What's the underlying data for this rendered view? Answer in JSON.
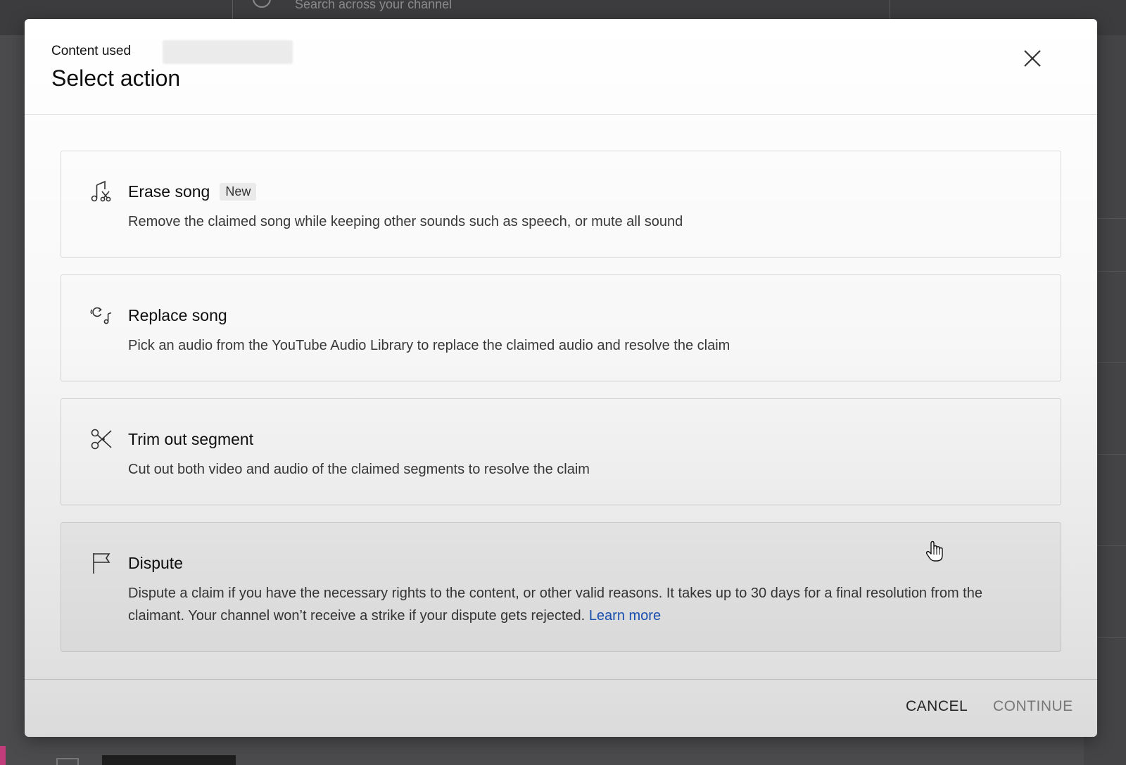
{
  "background": {
    "search_placeholder": "Search across your channel"
  },
  "dialog": {
    "subtitle": "Content used",
    "title": "Select action",
    "close_icon": "close-icon",
    "options": [
      {
        "icon": "music-scissors-icon",
        "title": "Erase song",
        "badge": "New",
        "description": "Remove the claimed song while keeping other sounds such as speech, or mute all sound"
      },
      {
        "icon": "replace-song-icon",
        "title": "Replace song",
        "description": "Pick an audio from the YouTube Audio Library to replace the claimed audio and resolve the claim"
      },
      {
        "icon": "scissors-icon",
        "title": "Trim out segment",
        "description": "Cut out both video and audio of the claimed segments to resolve the claim"
      },
      {
        "icon": "flag-icon",
        "title": "Dispute",
        "description": "Dispute a claim if you have the necessary rights to the content, or other valid reasons. It takes up to 30 days for a final resolution from the claimant. Your channel won’t receive a strike if your dispute gets rejected.",
        "link": "Learn more"
      }
    ],
    "footer": {
      "cancel_label": "CANCEL",
      "continue_label": "CONTINUE"
    }
  },
  "colors": {
    "link": "#1a57c4",
    "disabled_text": "#8a8a8a"
  }
}
